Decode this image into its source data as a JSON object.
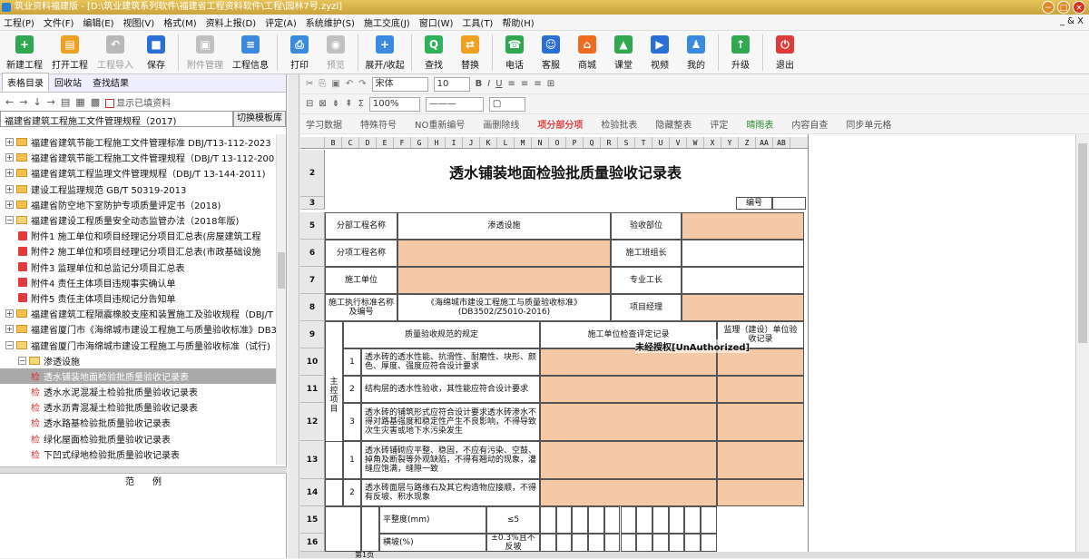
{
  "window": {
    "title": "筑业资料福建版 - [D:\\筑业建筑系列软件\\福建省工程资料软件\\工程\\园林7号.zyzl]"
  },
  "menu": [
    "工程(P)",
    "文件(F)",
    "编辑(E)",
    "视图(V)",
    "格式(M)",
    "资料上报(D)",
    "评定(A)",
    "系统维护(S)",
    "施工交底(J)",
    "窗口(W)",
    "工具(T)",
    "帮助(H)"
  ],
  "menu_right": "_ & X",
  "toolbar": [
    {
      "label": "新建工程",
      "icon": "+",
      "color": "#2fa84f",
      "dis": false
    },
    {
      "label": "打开工程",
      "icon": "▤",
      "color": "#f0a020",
      "dis": false
    },
    {
      "label": "工程导入",
      "icon": "↶",
      "color": "#b8b8b8",
      "dis": true
    },
    {
      "label": "保存",
      "icon": "■",
      "color": "#2a6fd6",
      "dis": false
    },
    {
      "label": "附件管理",
      "icon": "▣",
      "color": "#c0c0c0",
      "dis": true
    },
    {
      "label": "工程信息",
      "icon": "≡",
      "color": "#3a8ae0",
      "dis": false
    },
    {
      "label": "打印",
      "icon": "⎙",
      "color": "#3a8ae0",
      "dis": false
    },
    {
      "label": "预览",
      "icon": "◉",
      "color": "#c0c0c0",
      "dis": true
    },
    {
      "label": "展开/收起",
      "icon": "+",
      "color": "#3a8ae0",
      "dis": false
    },
    {
      "label": "查找",
      "icon": "Q",
      "color": "#2fb05a",
      "dis": false
    },
    {
      "label": "替换",
      "icon": "⇄",
      "color": "#f0a020",
      "dis": false
    },
    {
      "label": "电话",
      "icon": "☎",
      "color": "#2fa84f",
      "dis": false
    },
    {
      "label": "客服",
      "icon": "☺",
      "color": "#2a6fd6",
      "dis": false
    },
    {
      "label": "商城",
      "icon": "⌂",
      "color": "#f06a20",
      "dis": false
    },
    {
      "label": "课堂",
      "icon": "▲",
      "color": "#2fa84f",
      "dis": false
    },
    {
      "label": "视频",
      "icon": "▶",
      "color": "#2a6fd6",
      "dis": false
    },
    {
      "label": "我的",
      "icon": "♟",
      "color": "#3a8ae0",
      "dis": false
    },
    {
      "label": "升级",
      "icon": "↑",
      "color": "#2fa84f",
      "dis": false
    },
    {
      "label": "退出",
      "icon": "⏻",
      "color": "#e03a3a",
      "dis": false
    }
  ],
  "left": {
    "tabs": [
      "表格目录",
      "回收站",
      "查找结果"
    ],
    "show_filled": "显示已填资料",
    "spec": "福建省建筑工程施工文件管理规程（2017)",
    "switch_btn": "切换模板库",
    "tree": [
      {
        "t": "福建省建筑节能工程施工文件管理标准 DBJ/T13-112-2023",
        "k": "f",
        "i": 0
      },
      {
        "t": "福建省建筑节能工程施工文件管理规程（DBJ/T 13-112-200",
        "k": "f",
        "i": 0
      },
      {
        "t": "福建省建筑工程监理文件管理规程（DBJ/T 13-144-2011)",
        "k": "f",
        "i": 0
      },
      {
        "t": "建设工程监理规范 GB/T 50319-2013",
        "k": "f",
        "i": 0
      },
      {
        "t": "福建省防空地下室防护专项质量评定书（2018)",
        "k": "f",
        "i": 0
      },
      {
        "t": "福建省建设工程质量安全动态监管办法（2018年版)",
        "k": "fo",
        "i": 0
      },
      {
        "t": "附件1 施工单位和项目经理记分项目汇总表(房屋建筑工程",
        "k": "d",
        "i": 1
      },
      {
        "t": "附件2 施工单位和项目经理记分项目汇总表(市政基础设施",
        "k": "d",
        "i": 1
      },
      {
        "t": "附件3 监理单位和总监记分项目汇总表",
        "k": "d",
        "i": 1
      },
      {
        "t": "附件4 责任主体项目违规事实确认单",
        "k": "d",
        "i": 1
      },
      {
        "t": "附件5 责任主体项目违规记分告知单",
        "k": "d",
        "i": 1
      },
      {
        "t": "福建省建筑工程隔震橡胶支座和装置施工及验收规程（DBJ/T",
        "k": "f",
        "i": 0
      },
      {
        "t": "福建省厦门市《海绵城市建设工程施工与质量验收标准》DB3",
        "k": "f",
        "i": 0
      },
      {
        "t": "福建省厦门市海绵城市建设工程施工与质量验收标准（试行)",
        "k": "fo",
        "i": 0
      },
      {
        "t": "渗透设施",
        "k": "fo",
        "i": 1
      },
      {
        "t": "透水铺装地面检验批质量验收记录表",
        "k": "j",
        "i": 2,
        "sel": true
      },
      {
        "t": "透水水泥混凝土检验批质量验收记录表",
        "k": "j",
        "i": 2
      },
      {
        "t": "透水沥青混凝土检验批质量验收记录表",
        "k": "j",
        "i": 2
      },
      {
        "t": "透水路基检验批质量验收记录表",
        "k": "j",
        "i": 2
      },
      {
        "t": "绿化屋面检验批质量验收记录表",
        "k": "j",
        "i": 2
      },
      {
        "t": "下凹式绿地检验批质量验收记录表",
        "k": "j",
        "i": 2
      }
    ],
    "jian": "检",
    "example": "范　　例"
  },
  "sheet_toolbar": {
    "font": "宋体",
    "size": "10",
    "zoom": "100%",
    "row3": [
      "学习数据",
      "特殊符号",
      "NO重新编号",
      "画删除线",
      "项分部分项",
      "检验批表",
      "隐藏整表",
      "评定",
      "晴雨表",
      "内容自查",
      "同步单元格"
    ]
  },
  "sheet": {
    "cols": [
      "B",
      "C",
      "D",
      "E",
      "F",
      "G",
      "H",
      "I",
      "J",
      "K",
      "L",
      "M",
      "N",
      "O",
      "P",
      "Q",
      "R",
      "S",
      "T",
      "U",
      "V",
      "W",
      "X",
      "Y",
      "Z",
      "AA",
      "AB"
    ],
    "rows": [
      "2",
      "3",
      "5",
      "6",
      "7",
      "8",
      "9",
      "10",
      "11",
      "12",
      "13",
      "14",
      "15",
      "16"
    ],
    "title": "透水铺装地面检验批质量验收记录表",
    "code_label": "编号",
    "fenbu_label": "分部工程名称",
    "fenbu_value": "渗透设施",
    "yanshou_label": "验收部位",
    "fenxiang_label": "分项工程名称",
    "banzu_label": "施工班组长",
    "sgdw_label": "施工单位",
    "zhuanye_label": "专业工长",
    "standard_label": "施工执行标准名称及编号",
    "standard_value": "《海绵城市建设工程施工与质量验收标准》(DB3502/Z5010-2016)",
    "pm_label": "项目经理",
    "h1": "质量验收规范的规定",
    "h2": "施工单位检查评定记录",
    "h3": "监理（建设）单位验收记录",
    "zhukong": "主控项目",
    "items": [
      {
        "n": "1",
        "t": "透水砖的透水性能、抗滑性、耐磨性、块形、颜色、厚度、强度应符合设计要求"
      },
      {
        "n": "2",
        "t": "结构层的透水性验收，其性能应符合设计要求"
      },
      {
        "n": "3",
        "t": "透水砖的铺筑形式应符合设计要求透水砖渗水不得对路基强度和稳定性产生不良影响，不得导致次生灾害或地下水污染发生"
      },
      {
        "n": "1",
        "t": "透水砖铺砌应平整、稳固，不应有污染、空鼓、掉角及断裂等外观缺陷，不得有翘动的现象，灌缝应饱满，缝隙一致"
      },
      {
        "n": "2",
        "t": "透水砖面层与路缘石及其它构造物应接顺，不得有反坡、积水现象"
      }
    ],
    "r15_label": "平整度(mm)",
    "r15_val": "≤5",
    "r16_label": "横坡(%)",
    "r16_val": "±0.3%且不反坡",
    "watermark": "未经授权[UnAuthorized]"
  },
  "sheet_tabs": "第1页"
}
